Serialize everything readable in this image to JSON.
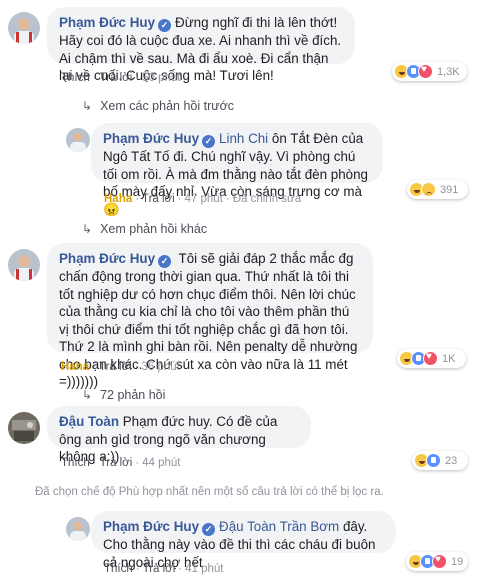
{
  "comments": [
    {
      "name": "Phạm Đức Huy",
      "text": "Đừng nghĩ đi thi là lên thớt! Hãy coi đó là cuộc đua xe. Ai nhanh thì về đích. Ai chậm thì về sau. Mà đi ẩu xoè. Đi cẩn thận lại về cuối. Cuộc sống mà! Tươi lên!",
      "like": "Thích",
      "reply": "Trả lời",
      "time": "50 phút",
      "reaction_count": "1,3K"
    },
    {
      "name": "Phạm Đức Huy",
      "tag": "Linh Chi",
      "text": " ôn Tắt Đèn của Ngô Tất Tố đi. Chú nghĩ vậy. Vì phòng chú tối om rồi. À mà đm thằng nào tắt đèn phòng bố mày đấy nhỉ. Vừa còn sáng trưng cơ mà 😠",
      "reaction_label": "Haha",
      "reply": "Trả lời",
      "time": "47 phút",
      "edited": "Đã chỉnh sửa",
      "reaction_count": "391"
    },
    {
      "name": "Phạm Đức Huy",
      "text": "Tôi sẽ giải đáp 2 thắc mắc đg chấn động trong thời gian qua. Thứ nhất là tôi thi tốt nghiệp dư có hơn chục điểm thôi. Nên lời chúc của thằng cu kia chỉ là cho tôi vào thêm phần thú vị thôi chứ điểm thi tốt nghiệp chắc gì đã hơn tôi. Thứ 2 là mình ghi bàn rồi. Nên penalty dễ nhường cho bạn khác. Chứ sút xa còn vào nữa là 11 mét =)))))))",
      "reaction_label": "Haha",
      "reply": "Trả lời",
      "time": "36 phút",
      "reaction_count": "1K"
    },
    {
      "name": "Đậu Toàn",
      "text": " Phạm đức huy. Có đề của ông anh gìd trong ngõ văn chương không a:))",
      "like": "Thích",
      "reply": "Trả lời",
      "time": "44 phút",
      "reaction_count": "23"
    },
    {
      "name": "Phạm Đức Huy",
      "tag": "Đậu Toàn Trần Bơm",
      "text": " đây. Cho thằng này vào đề thi thì các cháu đi buôn cả ngoài chợ hết",
      "like": "Thích",
      "reply": "Trả lời",
      "time": "41 phút",
      "reaction_count": "19"
    }
  ],
  "links": {
    "view_previous": "Xem các phản hồi trước",
    "view_other": "Xem phản hồi khác",
    "replies_72": "72 phản hồi"
  },
  "system_message": "Đã chọn chế độ Phù hợp nhất nên một số câu trả lời có thể bị lọc ra.",
  "colors": {
    "link_blue": "#385898",
    "bubble_bg": "#f2f3f5",
    "meta_gray": "#90949c",
    "haha_gold": "#d9a300"
  }
}
